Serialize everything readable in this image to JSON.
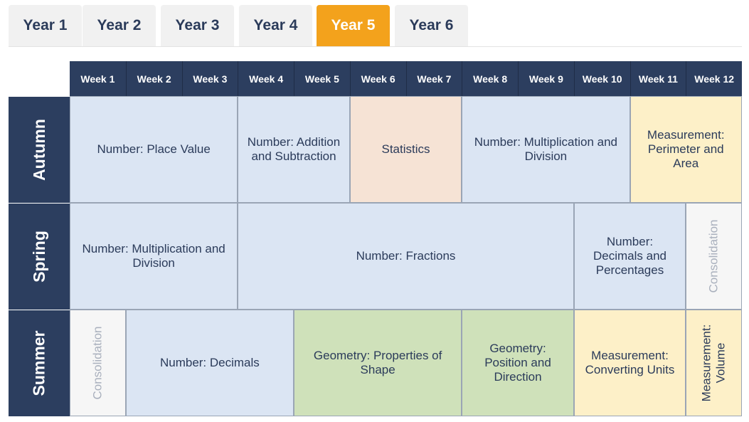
{
  "tabs": [
    {
      "label": "Year 1"
    },
    {
      "label": "Year 2"
    },
    {
      "label": "Year 3"
    },
    {
      "label": "Year 4"
    },
    {
      "label": "Year 5"
    },
    {
      "label": "Year 6"
    }
  ],
  "active_tab": "Year 5",
  "colors": {
    "header": "#2c3e5f",
    "active_tab": "#f3a21c",
    "number": "#dbe5f3",
    "statistics": "#f6e3d5",
    "measurement": "#fdf0c8",
    "geometry": "#cfe1ba",
    "consolidation": "#f6f6f6"
  },
  "weeks": [
    "Week 1",
    "Week 2",
    "Week 3",
    "Week 4",
    "Week 5",
    "Week 6",
    "Week 7",
    "Week 8",
    "Week 9",
    "Week 10",
    "Week 11",
    "Week 12"
  ],
  "terms": {
    "autumn": {
      "label": "Autumn",
      "blocks": [
        {
          "text": "Number: Place Value",
          "weeks": 3
        },
        {
          "text": "Number: Addition and Subtraction",
          "weeks": 2
        },
        {
          "text": "Statistics",
          "weeks": 2
        },
        {
          "text": "Number: Multiplication and Division",
          "weeks": 3
        },
        {
          "text": "Measurement: Perimeter and Area",
          "weeks": 2
        }
      ]
    },
    "spring": {
      "label": "Spring",
      "blocks": [
        {
          "text": "Number: Multiplication and Division",
          "weeks": 3
        },
        {
          "text": "Number: Fractions",
          "weeks": 6
        },
        {
          "text": "Number: Decimals and Percentages",
          "weeks": 2
        },
        {
          "text": "Consolidation",
          "weeks": 1
        }
      ]
    },
    "summer": {
      "label": "Summer",
      "blocks": [
        {
          "text": "Consolidation",
          "weeks": 1
        },
        {
          "text": "Number: Decimals",
          "weeks": 3
        },
        {
          "text": "Geometry: Properties of Shape",
          "weeks": 3
        },
        {
          "text": "Geometry: Position and Direction",
          "weeks": 2
        },
        {
          "text": "Measurement: Converting Units",
          "weeks": 2
        },
        {
          "text": "Measurement: Volume",
          "weeks": 1
        }
      ]
    }
  }
}
